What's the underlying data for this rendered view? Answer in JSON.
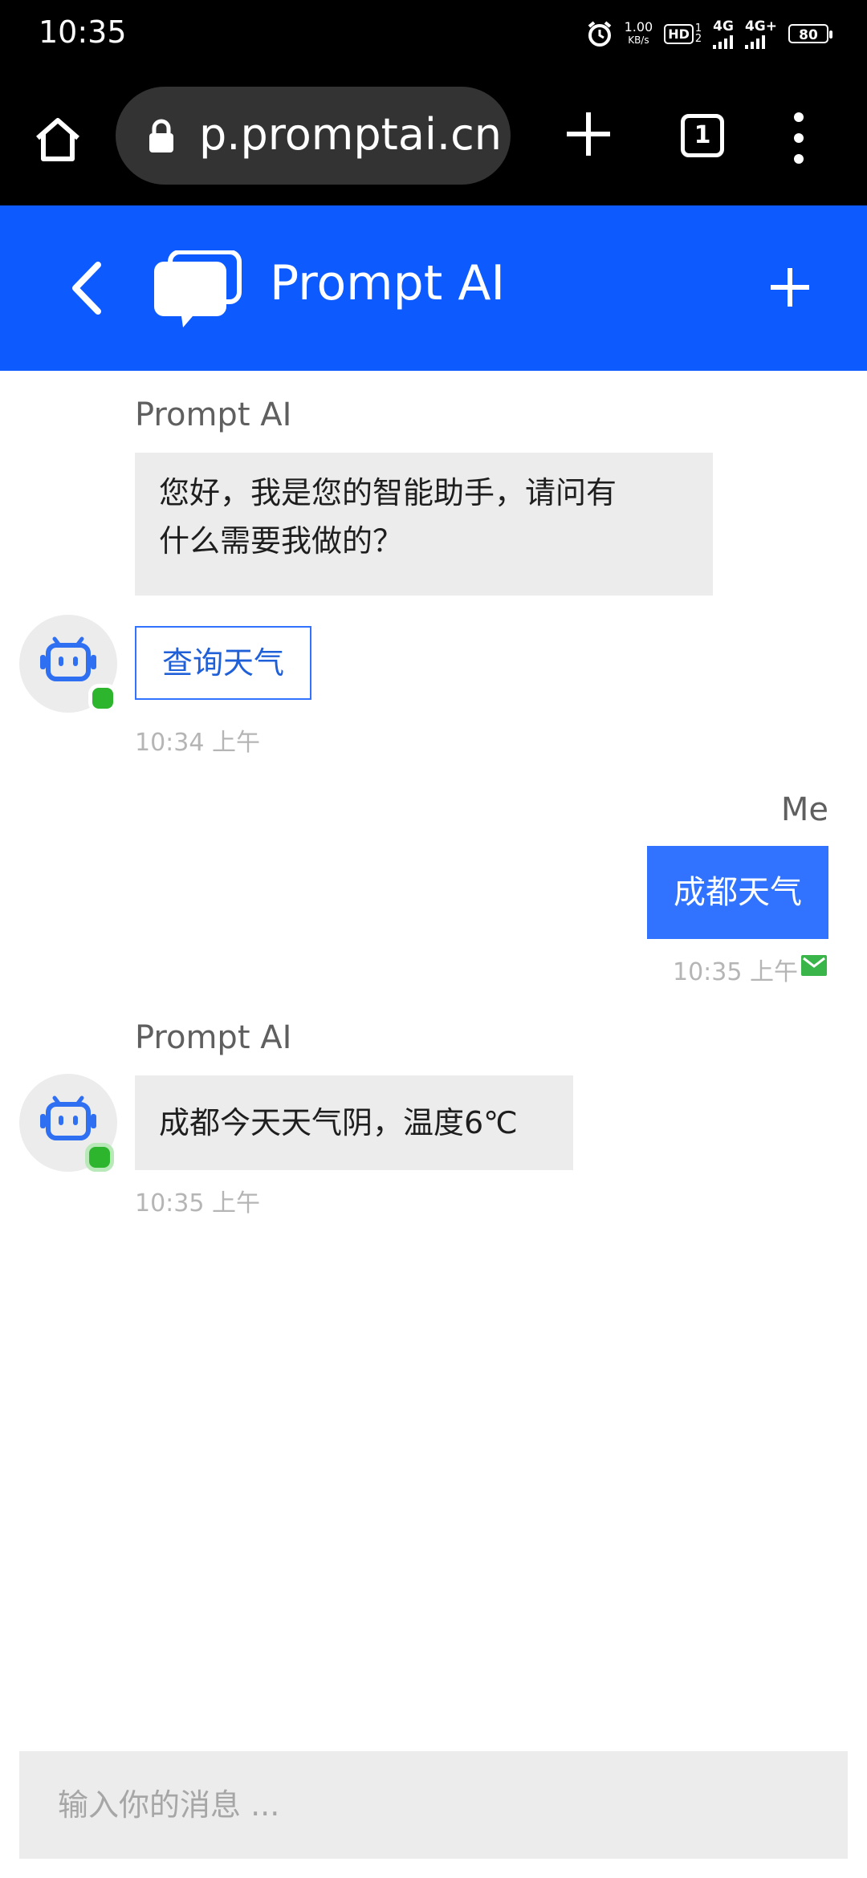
{
  "status_bar": {
    "time": "10:35",
    "net_speed_value": "1.00",
    "net_speed_unit": "KB/s",
    "hd_label": "HD",
    "sim1_label": "1",
    "sim2_label": "2",
    "network1": "4G",
    "network2": "4G+",
    "battery": "80"
  },
  "browser": {
    "url": "p.promptai.cn",
    "tab_count": "1"
  },
  "header": {
    "title": "Prompt AI",
    "accent_color": "#0d5bff"
  },
  "messages": [
    {
      "sender": "Prompt AI",
      "text_line1": "您好，我是您的智能助手，请问有",
      "text_line2": "什么需要我做的？",
      "quick_reply": "查询天气",
      "time": "10:34 上午"
    },
    {
      "sender": "Me",
      "text": "成都天气",
      "time": "10:35 上午"
    },
    {
      "sender": "Prompt AI",
      "text": "成都今天天气阴，温度6℃",
      "time": "10:35 上午"
    }
  ],
  "composer": {
    "placeholder": "输入你的消息 ..."
  },
  "colors": {
    "my_bubble": "#3173ff",
    "bot_bubble": "#ececec",
    "online": "#2db52d",
    "delivered": "#3ab54a"
  }
}
